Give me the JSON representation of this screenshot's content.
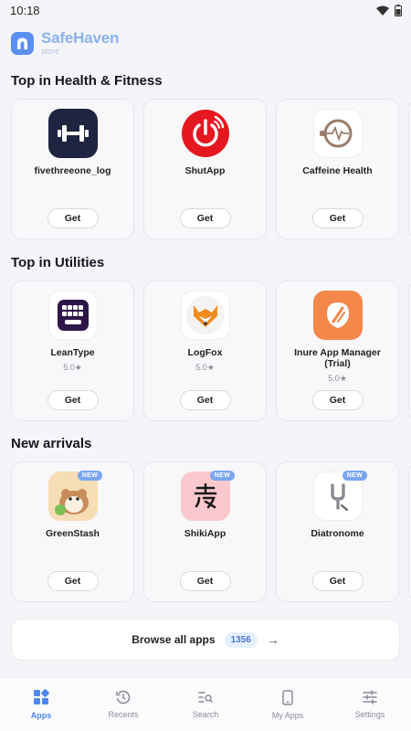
{
  "status": {
    "time": "10:18"
  },
  "header": {
    "brand_name": "SafeHaven",
    "brand_sub": "store"
  },
  "sections": [
    {
      "title": "Top in Health & Fitness",
      "apps": [
        {
          "name": "fivethreeone_log",
          "rating": "",
          "icon": "dumbbell-icon",
          "button": "Get"
        },
        {
          "name": "ShutApp",
          "rating": "",
          "icon": "power-icon",
          "button": "Get"
        },
        {
          "name": "Caffeine Health",
          "rating": "",
          "icon": "coffee-heartbeat-icon",
          "button": "Get"
        }
      ]
    },
    {
      "title": "Top in Utilities",
      "apps": [
        {
          "name": "LeanType",
          "rating": "5.0★",
          "icon": "keyboard-icon",
          "button": "Get"
        },
        {
          "name": "LogFox",
          "rating": "5.0★",
          "icon": "fox-icon",
          "button": "Get"
        },
        {
          "name": "Inure App Manager (Trial)",
          "rating": "5.0★",
          "icon": "inure-icon",
          "button": "Get"
        }
      ]
    },
    {
      "title": "New arrivals",
      "apps": [
        {
          "name": "GreenStash",
          "badge": "NEW",
          "icon": "hamster-icon",
          "button": "Get"
        },
        {
          "name": "ShikiApp",
          "badge": "NEW",
          "icon": "shiki-icon",
          "button": "Get"
        },
        {
          "name": "Diatronome",
          "badge": "NEW",
          "icon": "tuning-fork-icon",
          "button": "Get"
        }
      ]
    }
  ],
  "browse": {
    "label": "Browse all apps",
    "count": "1356"
  },
  "nav": [
    {
      "label": "Apps",
      "icon": "apps-grid-icon",
      "active": true
    },
    {
      "label": "Recents",
      "icon": "history-icon",
      "active": false
    },
    {
      "label": "Search",
      "icon": "search-list-icon",
      "active": false
    },
    {
      "label": "My Apps",
      "icon": "phone-icon",
      "active": false
    },
    {
      "label": "Settings",
      "icon": "sliders-icon",
      "active": false
    }
  ],
  "colors": {
    "accent": "#4e86ee",
    "brand": "#8bb1ef",
    "badge": "#7aa6f3"
  }
}
